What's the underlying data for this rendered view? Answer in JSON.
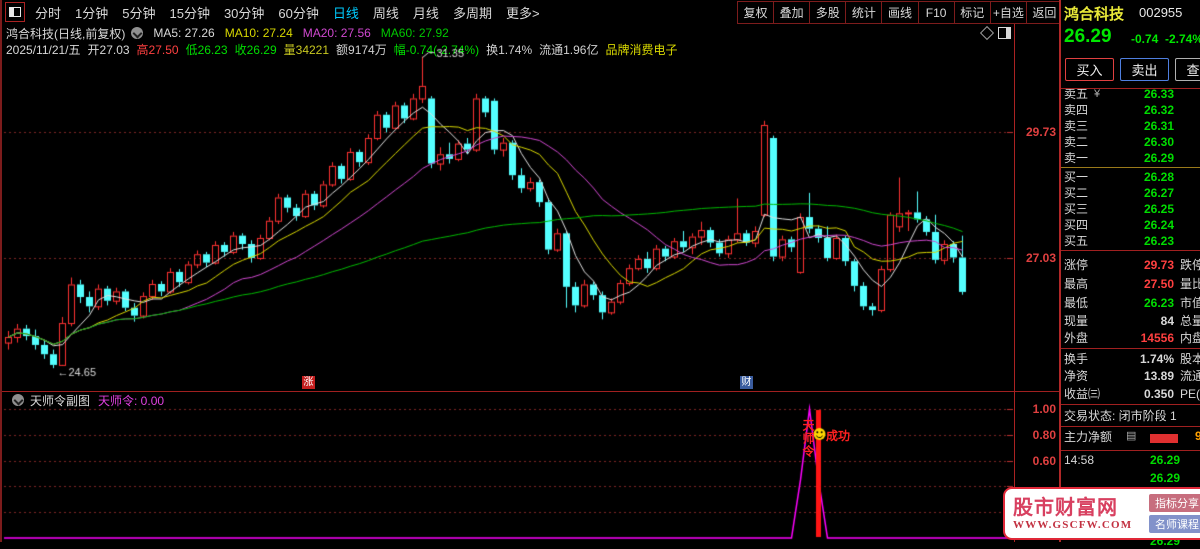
{
  "toolbar": {
    "left_items": [
      "分时",
      "1分钟",
      "5分钟",
      "15分钟",
      "30分钟",
      "60分钟",
      "日线",
      "周线",
      "月线",
      "多周期",
      "更多>"
    ],
    "active_item": "日线",
    "right_items": [
      "复权",
      "叠加",
      "多股",
      "统计",
      "画线",
      "F10",
      "标记",
      "+自选",
      "返回"
    ]
  },
  "chart_header": {
    "instrument": "鸿合科技(日线,前复权)",
    "ma_values": [
      {
        "text": "MA5: 27.26",
        "color": "#d8d8d8"
      },
      {
        "text": "MA10: 27.24",
        "color": "#d8d800"
      },
      {
        "text": "MA20: 27.56",
        "color": "#d048d0"
      },
      {
        "text": "MA60: 27.92",
        "color": "#00c800"
      }
    ],
    "info_segments": [
      {
        "text": "2025/11/21/五",
        "color": "#d8d8d8"
      },
      {
        "text": "开27.03",
        "color": "#d8d8d8"
      },
      {
        "text": "高27.50",
        "color": "#ff4040"
      },
      {
        "text": "低26.23",
        "color": "#00dd00"
      },
      {
        "text": "收26.29",
        "color": "#00dd00"
      },
      {
        "text": "量34221",
        "color": "#c8c820"
      },
      {
        "text": "额9174万",
        "color": "#d0d0d0"
      },
      {
        "text": "幅-0.74(-2.74%)",
        "color": "#00dd00"
      },
      {
        "text": "换1.74%",
        "color": "#d0d0d0"
      },
      {
        "text": "流通1.96亿",
        "color": "#d0d0d0"
      },
      {
        "text": "品牌消费电子",
        "color": "#d8d800"
      }
    ]
  },
  "chart_data": {
    "type": "candlestick",
    "title": "鸿合科技 日线",
    "ylim": [
      24.2,
      31.4
    ],
    "grid_prices": [
      29.73,
      27.03
    ],
    "axis_labels": [
      {
        "text": "29.73",
        "price": 29.73
      },
      {
        "text": "27.03",
        "price": 27.03
      }
    ],
    "annotations": {
      "high": {
        "text": "31.35",
        "index": 46,
        "price": 31.35
      },
      "low": {
        "text": "24.65",
        "index": 5,
        "price": 24.65
      }
    },
    "event_badges": [
      {
        "text": "涨",
        "x": 300,
        "bg": "#c41e1e"
      },
      {
        "text": "财",
        "x": 738,
        "bg": "#3a5c9e"
      }
    ],
    "ma_windows": [
      5,
      10,
      20,
      60
    ],
    "candles": [
      [
        25.2,
        25.45,
        25.05,
        25.32
      ],
      [
        25.32,
        25.6,
        25.2,
        25.5
      ],
      [
        25.5,
        25.58,
        25.25,
        25.34
      ],
      [
        25.34,
        25.48,
        25.05,
        25.15
      ],
      [
        25.15,
        25.25,
        24.85,
        24.95
      ],
      [
        24.95,
        25.05,
        24.65,
        24.72
      ],
      [
        24.72,
        25.75,
        24.7,
        25.62
      ],
      [
        25.62,
        26.6,
        25.55,
        26.45
      ],
      [
        26.45,
        26.55,
        26.05,
        26.18
      ],
      [
        26.18,
        26.3,
        25.85,
        25.98
      ],
      [
        25.98,
        26.45,
        25.9,
        26.36
      ],
      [
        26.36,
        26.42,
        26.0,
        26.1
      ],
      [
        26.1,
        26.38,
        26.02,
        26.3
      ],
      [
        26.3,
        26.35,
        25.88,
        25.95
      ],
      [
        25.95,
        26.05,
        25.65,
        25.78
      ],
      [
        25.78,
        26.28,
        25.72,
        26.2
      ],
      [
        26.2,
        26.55,
        26.12,
        26.46
      ],
      [
        26.46,
        26.52,
        26.2,
        26.3
      ],
      [
        26.3,
        26.8,
        26.25,
        26.72
      ],
      [
        26.72,
        26.78,
        26.4,
        26.5
      ],
      [
        26.5,
        26.95,
        26.45,
        26.88
      ],
      [
        26.88,
        27.18,
        26.8,
        27.1
      ],
      [
        27.1,
        27.15,
        26.82,
        26.92
      ],
      [
        26.92,
        27.38,
        26.88,
        27.3
      ],
      [
        27.3,
        27.36,
        27.05,
        27.15
      ],
      [
        27.15,
        27.58,
        27.1,
        27.5
      ],
      [
        27.5,
        27.55,
        27.2,
        27.32
      ],
      [
        27.32,
        27.4,
        26.92,
        27.02
      ],
      [
        27.02,
        27.52,
        26.98,
        27.45
      ],
      [
        27.45,
        27.9,
        27.4,
        27.82
      ],
      [
        27.82,
        28.4,
        27.75,
        28.32
      ],
      [
        28.32,
        28.38,
        28.0,
        28.1
      ],
      [
        28.1,
        28.18,
        27.82,
        27.92
      ],
      [
        27.92,
        28.48,
        27.88,
        28.4
      ],
      [
        28.4,
        28.46,
        28.05,
        28.15
      ],
      [
        28.15,
        28.68,
        28.1,
        28.6
      ],
      [
        28.6,
        29.08,
        28.55,
        29.0
      ],
      [
        29.0,
        29.05,
        28.62,
        28.72
      ],
      [
        28.72,
        29.38,
        28.68,
        29.3
      ],
      [
        29.3,
        29.35,
        28.98,
        29.08
      ],
      [
        29.08,
        29.68,
        29.02,
        29.6
      ],
      [
        29.6,
        30.18,
        29.55,
        30.1
      ],
      [
        30.1,
        30.16,
        29.72,
        29.82
      ],
      [
        29.82,
        30.38,
        29.78,
        30.3
      ],
      [
        30.3,
        30.36,
        29.92,
        30.02
      ],
      [
        30.02,
        30.55,
        29.98,
        30.45
      ],
      [
        30.45,
        31.35,
        30.35,
        30.72
      ],
      [
        30.45,
        30.5,
        28.95,
        29.05
      ],
      [
        29.05,
        29.4,
        28.9,
        29.25
      ],
      [
        29.25,
        29.5,
        29.05,
        29.15
      ],
      [
        29.15,
        29.55,
        29.1,
        29.48
      ],
      [
        29.48,
        29.6,
        29.25,
        29.35
      ],
      [
        29.35,
        30.55,
        29.3,
        30.45
      ],
      [
        30.45,
        30.5,
        30.05,
        30.15
      ],
      [
        30.4,
        30.45,
        29.25,
        29.35
      ],
      [
        29.35,
        29.6,
        29.2,
        29.5
      ],
      [
        29.5,
        29.55,
        28.7,
        28.8
      ],
      [
        28.8,
        28.95,
        28.42,
        28.52
      ],
      [
        28.52,
        28.75,
        28.45,
        28.65
      ],
      [
        28.65,
        28.7,
        28.12,
        28.22
      ],
      [
        28.22,
        28.3,
        27.1,
        27.2
      ],
      [
        27.2,
        27.65,
        27.15,
        27.55
      ],
      [
        27.55,
        27.6,
        25.95,
        26.4
      ],
      [
        26.4,
        26.5,
        25.85,
        26.0
      ],
      [
        26.0,
        26.55,
        25.95,
        26.45
      ],
      [
        26.45,
        26.5,
        26.12,
        26.22
      ],
      [
        26.22,
        26.3,
        25.7,
        25.85
      ],
      [
        25.85,
        26.15,
        25.8,
        26.08
      ],
      [
        26.08,
        26.55,
        26.02,
        26.48
      ],
      [
        26.48,
        26.88,
        26.42,
        26.8
      ],
      [
        26.8,
        27.08,
        26.75,
        27.0
      ],
      [
        27.0,
        27.15,
        26.7,
        26.8
      ],
      [
        26.8,
        27.3,
        26.75,
        27.22
      ],
      [
        27.22,
        27.28,
        26.95,
        27.05
      ],
      [
        27.05,
        27.45,
        27.0,
        27.38
      ],
      [
        27.38,
        27.6,
        27.15,
        27.25
      ],
      [
        27.25,
        27.55,
        27.1,
        27.48
      ],
      [
        27.48,
        27.8,
        27.3,
        27.62
      ],
      [
        27.62,
        27.68,
        27.25,
        27.35
      ],
      [
        27.35,
        27.42,
        27.05,
        27.12
      ],
      [
        27.12,
        27.5,
        27.02,
        27.42
      ],
      [
        27.42,
        28.3,
        27.35,
        27.55
      ],
      [
        27.55,
        27.62,
        27.28,
        27.35
      ],
      [
        27.35,
        27.7,
        27.25,
        27.6
      ],
      [
        27.95,
        29.97,
        27.9,
        29.88
      ],
      [
        29.6,
        29.65,
        26.95,
        27.05
      ],
      [
        27.05,
        27.5,
        26.95,
        27.42
      ],
      [
        27.42,
        27.48,
        27.15,
        27.25
      ],
      [
        26.72,
        27.98,
        26.68,
        27.9
      ],
      [
        27.9,
        28.42,
        27.55,
        27.65
      ],
      [
        27.65,
        27.72,
        27.35,
        27.45
      ],
      [
        27.45,
        27.7,
        26.95,
        27.02
      ],
      [
        27.02,
        27.52,
        26.98,
        27.45
      ],
      [
        27.45,
        27.5,
        26.85,
        26.95
      ],
      [
        26.95,
        27.0,
        26.3,
        26.42
      ],
      [
        26.42,
        26.5,
        25.9,
        25.98
      ],
      [
        25.98,
        26.05,
        25.78,
        25.9
      ],
      [
        25.9,
        26.85,
        25.85,
        26.78
      ],
      [
        26.78,
        28.0,
        26.72,
        27.95
      ],
      [
        27.7,
        28.75,
        27.58,
        27.98
      ],
      [
        27.98,
        28.05,
        27.6,
        28.0
      ],
      [
        28.0,
        28.45,
        27.78,
        27.85
      ],
      [
        27.85,
        27.92,
        27.5,
        27.58
      ],
      [
        27.58,
        27.95,
        26.9,
        26.98
      ],
      [
        26.98,
        27.4,
        26.88,
        27.32
      ],
      [
        27.32,
        27.38,
        26.92,
        27.03
      ],
      [
        27.03,
        27.5,
        26.23,
        26.29
      ]
    ]
  },
  "sub_chart": {
    "title": "天师令副图",
    "value_label": "天师令: 0.00",
    "axis_labels": [
      {
        "text": "1.00",
        "value": 1.0
      },
      {
        "text": "0.80",
        "value": 0.8
      },
      {
        "text": "0.60",
        "value": 0.6
      }
    ],
    "grid_values": [
      1.0,
      0.8,
      0.6,
      0.4,
      0.2
    ],
    "spike_points": [
      [
        87,
        0
      ],
      [
        88,
        0.45
      ],
      [
        89,
        1.0
      ],
      [
        90,
        0.45
      ],
      [
        91,
        0
      ]
    ],
    "signal_bar_index": 90,
    "signal_text_vertical": "天师令",
    "signal_text": "成功",
    "smiley_icon": "smiley-face"
  },
  "colors": {
    "up": "#ff3232",
    "down": "#54ffff",
    "ma5": "#e0e0e0",
    "ma10": "#d8d800",
    "ma20": "#d048d0",
    "ma60": "#00bb00",
    "grid": "#7d2424",
    "axis_label": "#e04040",
    "spike_line": "#ff00ff",
    "signal_bar": "#ff1414",
    "annotation": "#d8d8d8"
  },
  "quote_panel": {
    "title": "鸿合科技",
    "code": "002955",
    "last": "26.29",
    "change": "-0.74",
    "change_pct": "-2.74%",
    "buttons": [
      {
        "label": "买入",
        "border": "#e04040"
      },
      {
        "label": "卖出",
        "border": "#4f7fe0"
      },
      {
        "label": "查询",
        "border": "#b0b0b0"
      }
    ],
    "currency_mark": "¥",
    "asks": [
      {
        "label": "卖五",
        "price": "26.33"
      },
      {
        "label": "卖四",
        "price": "26.32"
      },
      {
        "label": "卖三",
        "price": "26.31"
      },
      {
        "label": "卖二",
        "price": "26.30"
      },
      {
        "label": "卖一",
        "price": "26.29"
      }
    ],
    "bids": [
      {
        "label": "买一",
        "price": "26.28"
      },
      {
        "label": "买二",
        "price": "26.27"
      },
      {
        "label": "买三",
        "price": "26.25"
      },
      {
        "label": "买四",
        "price": "26.24"
      },
      {
        "label": "买五",
        "price": "26.23"
      }
    ],
    "fields": [
      {
        "label": "涨停",
        "value": "29.73",
        "vc": "#ff4040",
        "label2": "跌停"
      },
      {
        "label": "最高",
        "value": "27.50",
        "vc": "#ff4040",
        "label2": "量比"
      },
      {
        "label": "最低",
        "value": "26.23",
        "vc": "#00dd00",
        "label2": "市值"
      },
      {
        "label": "现量",
        "value": "84",
        "vc": "#d8d8d8",
        "label2": "总量"
      },
      {
        "label": "外盘",
        "value": "14556",
        "vc": "#ff4040",
        "label2": "内盘"
      },
      {
        "label": "换手",
        "value": "1.74%",
        "vc": "#d8d8d8",
        "label2": "股本"
      },
      {
        "label": "净资",
        "value": "13.89",
        "vc": "#d8d8d8",
        "label2": "流通"
      },
      {
        "label": "收益㈢",
        "value": "0.350",
        "vc": "#d8d8d8",
        "label2": "PE(动"
      }
    ],
    "status": "交易状态: 闭市阶段 1",
    "main_flow_label": "主力净额",
    "main_flow_num": "9",
    "ticks": [
      {
        "time": "14:58",
        "price": "26.29"
      },
      {
        "time": "",
        "price": "26.29"
      },
      {
        "time": "",
        "price": "26.29"
      }
    ]
  },
  "watermark": {
    "title": "股市财富网",
    "url": "WWW.GSCFW.COM",
    "badges": [
      {
        "label": "指标分享",
        "bg": "#c76e7e"
      },
      {
        "label": "名师课程",
        "bg": "#8292ca"
      }
    ]
  }
}
